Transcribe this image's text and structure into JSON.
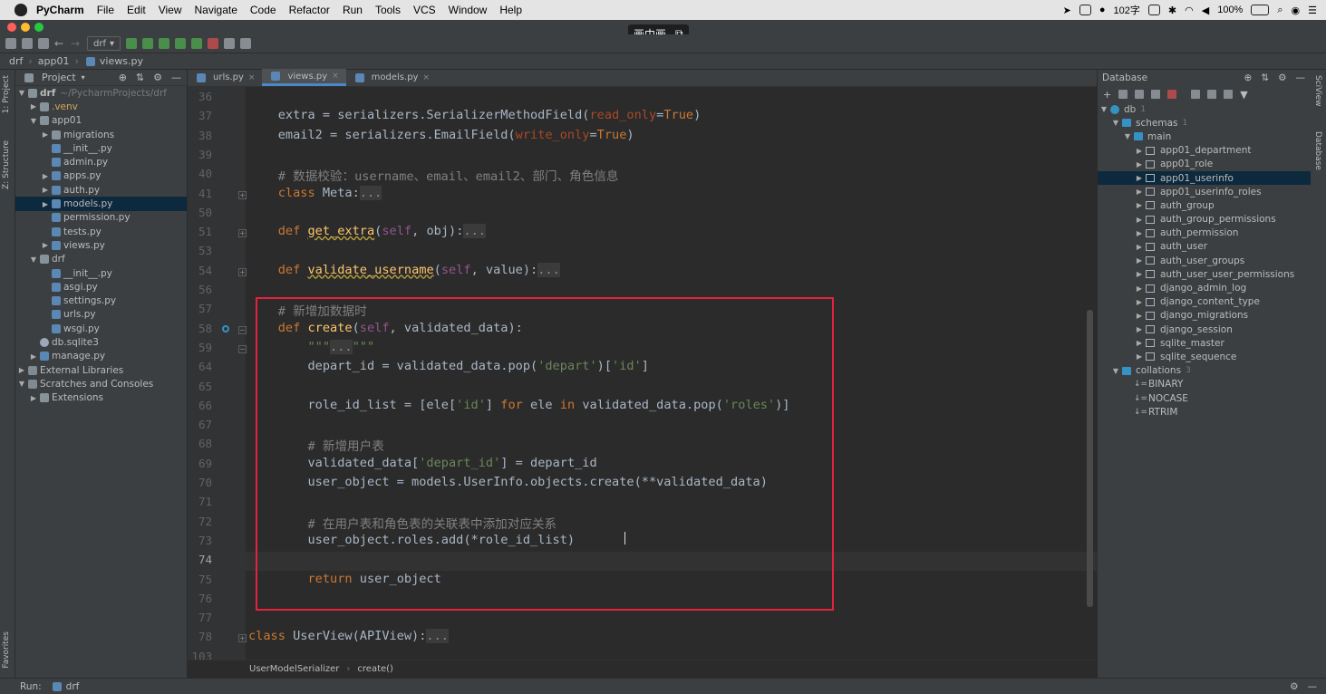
{
  "menubar": {
    "app_name": "PyCharm",
    "items": [
      "File",
      "Edit",
      "View",
      "Navigate",
      "Code",
      "Refactor",
      "Run",
      "Tools",
      "VCS",
      "Window",
      "Help"
    ],
    "status_text": "102字",
    "battery": "100%"
  },
  "pip_overlay": {
    "label": "画中画"
  },
  "toolbar": {
    "run_config": "drf"
  },
  "navbar": {
    "crumbs": [
      "drf",
      "app01",
      "views.py"
    ]
  },
  "left_strip": {
    "project_tab": "1: Project",
    "structure_tab": "Z: Structure",
    "favorites_tab": "Favorites"
  },
  "project_panel": {
    "title": "Project",
    "tree": [
      {
        "depth": 0,
        "arrow": "▼",
        "icon": "dir",
        "label": "drf",
        "suffix": "~/PycharmProjects/drf"
      },
      {
        "depth": 1,
        "arrow": "▶",
        "icon": "dir",
        "label": ".venv",
        "color": "#d0a65f"
      },
      {
        "depth": 1,
        "arrow": "▼",
        "icon": "dir",
        "label": "app01"
      },
      {
        "depth": 2,
        "arrow": "▶",
        "icon": "dir",
        "label": "migrations"
      },
      {
        "depth": 2,
        "arrow": "",
        "icon": "py",
        "label": "__init__.py"
      },
      {
        "depth": 2,
        "arrow": "",
        "icon": "py",
        "label": "admin.py"
      },
      {
        "depth": 2,
        "arrow": "▶",
        "icon": "py",
        "label": "apps.py"
      },
      {
        "depth": 2,
        "arrow": "▶",
        "icon": "py",
        "label": "auth.py"
      },
      {
        "depth": 2,
        "arrow": "▶",
        "icon": "py",
        "label": "models.py",
        "selected": true
      },
      {
        "depth": 2,
        "arrow": "",
        "icon": "py",
        "label": "permission.py"
      },
      {
        "depth": 2,
        "arrow": "",
        "icon": "py",
        "label": "tests.py"
      },
      {
        "depth": 2,
        "arrow": "▶",
        "icon": "py",
        "label": "views.py"
      },
      {
        "depth": 1,
        "arrow": "▼",
        "icon": "dir",
        "label": "drf"
      },
      {
        "depth": 2,
        "arrow": "",
        "icon": "py",
        "label": "__init__.py"
      },
      {
        "depth": 2,
        "arrow": "",
        "icon": "py",
        "label": "asgi.py"
      },
      {
        "depth": 2,
        "arrow": "",
        "icon": "py",
        "label": "settings.py"
      },
      {
        "depth": 2,
        "arrow": "",
        "icon": "py",
        "label": "urls.py"
      },
      {
        "depth": 2,
        "arrow": "",
        "icon": "py",
        "label": "wsgi.py"
      },
      {
        "depth": 1,
        "arrow": "",
        "icon": "db",
        "label": "db.sqlite3"
      },
      {
        "depth": 1,
        "arrow": "▶",
        "icon": "py",
        "label": "manage.py"
      },
      {
        "depth": 0,
        "arrow": "▶",
        "icon": "lib",
        "label": "External Libraries"
      },
      {
        "depth": 0,
        "arrow": "▼",
        "icon": "lib",
        "label": "Scratches and Consoles"
      },
      {
        "depth": 1,
        "arrow": "▶",
        "icon": "dir",
        "label": "Extensions"
      }
    ]
  },
  "editor": {
    "tabs": [
      {
        "label": "urls.py",
        "active": false
      },
      {
        "label": "views.py",
        "active": true
      },
      {
        "label": "models.py",
        "active": false
      }
    ],
    "line_numbers": [
      "36",
      "37",
      "38",
      "39",
      "40",
      "41",
      "50",
      "51",
      "53",
      "54",
      "56",
      "57",
      "58",
      "59",
      "64",
      "65",
      "66",
      "67",
      "68",
      "69",
      "70",
      "71",
      "72",
      "73",
      "74",
      "75",
      "76",
      "77",
      "78",
      "103"
    ],
    "current_line": "74",
    "lines": [
      "",
      "    extra = serializers.SerializerMethodField(read_only=True)",
      "    email2 = serializers.EmailField(write_only=True)",
      "",
      "    # 数据校验：username、email、email2、部门、角色信息",
      "    class Meta:...",
      "",
      "    def get_extra(self, obj):...",
      "",
      "    def validate_username(self, value):...",
      "",
      "    # 新增加数据时",
      "    def create(self, validated_data):",
      "        \"\"\"...\"\"\"",
      "        depart_id = validated_data.pop('depart')['id']",
      "",
      "        role_id_list = [ele['id'] for ele in validated_data.pop('roles')]",
      "",
      "        # 新增用户表",
      "        validated_data['depart_id'] = depart_id",
      "        user_object = models.UserInfo.objects.create(**validated_data)",
      "",
      "        # 在用户表和角色表的关联表中添加对应关系",
      "        user_object.roles.add(*role_id_list)",
      "",
      "        return user_object",
      "",
      "",
      "class UserView(APIView):...",
      ""
    ],
    "breadcrumb": [
      "UserModelSerializer",
      "create()"
    ]
  },
  "database_panel": {
    "title": "Database",
    "tree": [
      {
        "depth": 0,
        "arrow": "▼",
        "icon": "db",
        "label": "db",
        "count": "1"
      },
      {
        "depth": 1,
        "arrow": "▼",
        "icon": "folder",
        "label": "schemas",
        "count": "1"
      },
      {
        "depth": 2,
        "arrow": "▼",
        "icon": "folder",
        "label": "main"
      },
      {
        "depth": 3,
        "arrow": "▶",
        "icon": "table",
        "label": "app01_department"
      },
      {
        "depth": 3,
        "arrow": "▶",
        "icon": "table",
        "label": "app01_role"
      },
      {
        "depth": 3,
        "arrow": "▶",
        "icon": "table",
        "label": "app01_userinfo",
        "selected": true
      },
      {
        "depth": 3,
        "arrow": "▶",
        "icon": "table",
        "label": "app01_userinfo_roles"
      },
      {
        "depth": 3,
        "arrow": "▶",
        "icon": "table",
        "label": "auth_group"
      },
      {
        "depth": 3,
        "arrow": "▶",
        "icon": "table",
        "label": "auth_group_permissions"
      },
      {
        "depth": 3,
        "arrow": "▶",
        "icon": "table",
        "label": "auth_permission"
      },
      {
        "depth": 3,
        "arrow": "▶",
        "icon": "table",
        "label": "auth_user"
      },
      {
        "depth": 3,
        "arrow": "▶",
        "icon": "table",
        "label": "auth_user_groups"
      },
      {
        "depth": 3,
        "arrow": "▶",
        "icon": "table",
        "label": "auth_user_user_permissions"
      },
      {
        "depth": 3,
        "arrow": "▶",
        "icon": "table",
        "label": "django_admin_log"
      },
      {
        "depth": 3,
        "arrow": "▶",
        "icon": "table",
        "label": "django_content_type"
      },
      {
        "depth": 3,
        "arrow": "▶",
        "icon": "table",
        "label": "django_migrations"
      },
      {
        "depth": 3,
        "arrow": "▶",
        "icon": "table",
        "label": "django_session"
      },
      {
        "depth": 3,
        "arrow": "▶",
        "icon": "table",
        "label": "sqlite_master"
      },
      {
        "depth": 3,
        "arrow": "▶",
        "icon": "table",
        "label": "sqlite_sequence"
      },
      {
        "depth": 1,
        "arrow": "▼",
        "icon": "folder",
        "label": "collations",
        "count": "3"
      },
      {
        "depth": 2,
        "arrow": "",
        "icon": "collation",
        "label": "BINARY"
      },
      {
        "depth": 2,
        "arrow": "",
        "icon": "collation",
        "label": "NOCASE"
      },
      {
        "depth": 2,
        "arrow": "",
        "icon": "collation",
        "label": "RTRIM"
      }
    ]
  },
  "right_strip": {
    "sciview_tab": "SciView",
    "database_tab": "Database"
  },
  "bottombar": {
    "run_label": "Run:",
    "run_target": "drf"
  }
}
